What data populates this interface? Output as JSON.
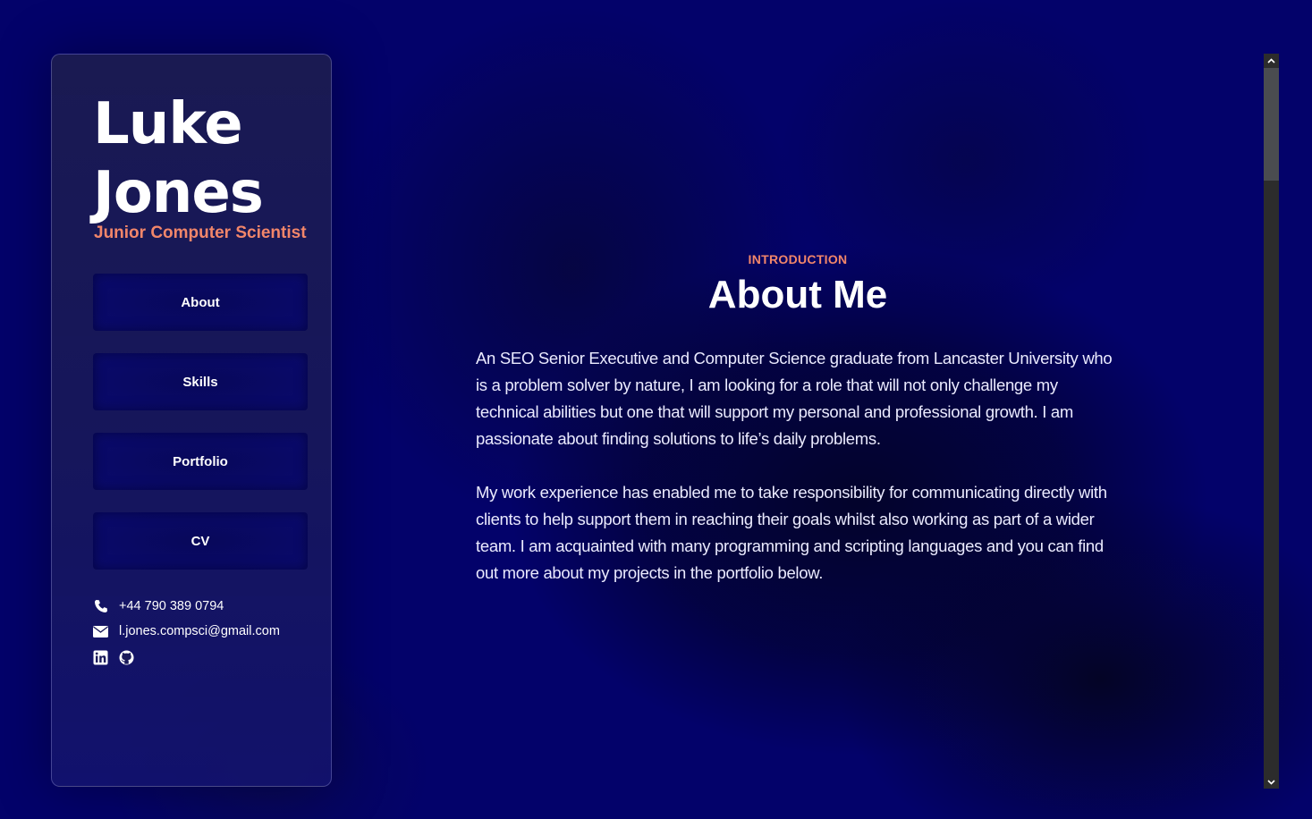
{
  "sidebar": {
    "name_line1": "Luke",
    "name_line2": "Jones",
    "subtitle": "Junior Computer Scientist",
    "nav": [
      {
        "label": "About"
      },
      {
        "label": "Skills"
      },
      {
        "label": "Portfolio"
      },
      {
        "label": "CV"
      }
    ],
    "contact": {
      "phone": "+44 790 389 0794",
      "email": "l.jones.compsci@gmail.com",
      "phone_icon": "phone-icon",
      "email_icon": "envelope-icon",
      "social_icons": [
        "linkedin-icon",
        "github-icon"
      ]
    }
  },
  "main": {
    "eyebrow": "INTRODUCTION",
    "heading": "About Me",
    "paragraphs": [
      "An SEO Senior Executive and Computer Science graduate from Lancaster University who is a problem solver by nature, I am looking for a role that will not only challenge my technical abilities but one that will support my personal and professional growth. I am passionate about finding solutions to life’s daily problems.",
      "My work experience has enabled me to take responsibility for communicating directly with clients to help support them in reaching their goals whilst also working as part of a wider team. I am acquainted with many programming and scripting languages and you can find out more about my projects in the portfolio below."
    ]
  },
  "colors": {
    "background": "#03026a",
    "accent": "#f2866a",
    "sidebar_border": "#8282c8"
  }
}
